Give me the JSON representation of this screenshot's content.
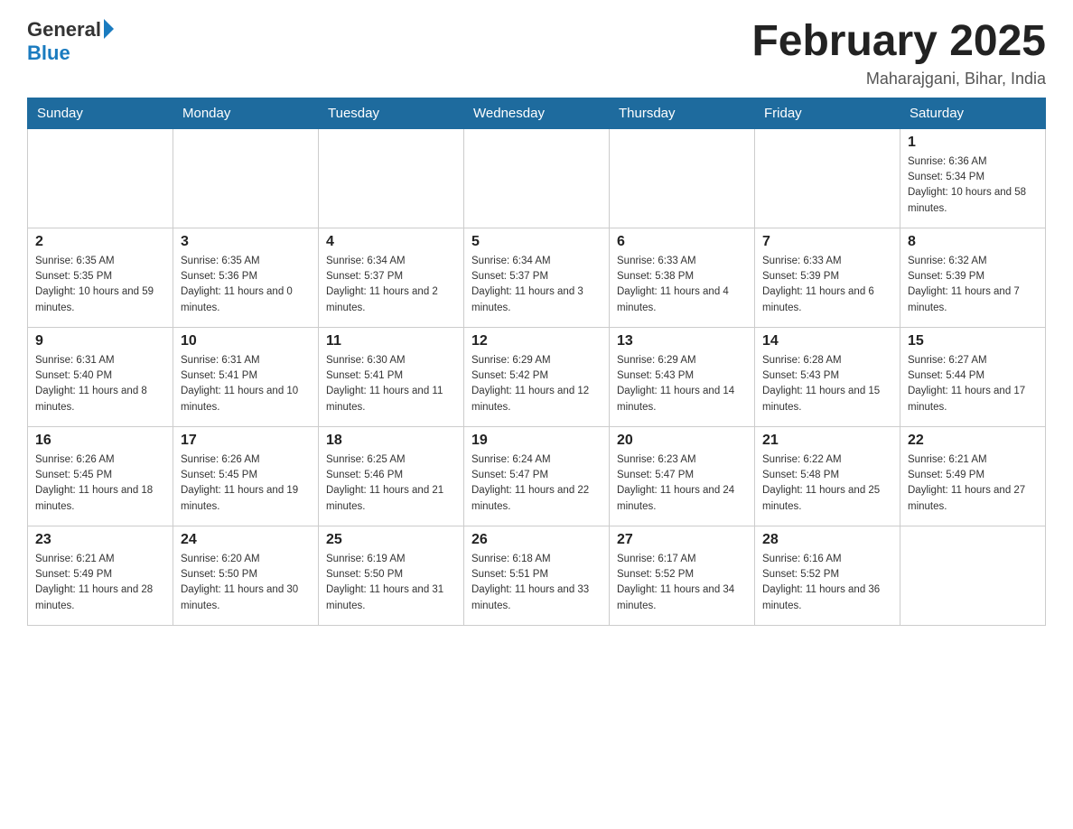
{
  "header": {
    "logo": {
      "general": "General",
      "blue": "Blue"
    },
    "title": "February 2025",
    "location": "Maharajgani, Bihar, India"
  },
  "weekdays": [
    "Sunday",
    "Monday",
    "Tuesday",
    "Wednesday",
    "Thursday",
    "Friday",
    "Saturday"
  ],
  "weeks": [
    [
      {
        "day": "",
        "sunrise": "",
        "sunset": "",
        "daylight": ""
      },
      {
        "day": "",
        "sunrise": "",
        "sunset": "",
        "daylight": ""
      },
      {
        "day": "",
        "sunrise": "",
        "sunset": "",
        "daylight": ""
      },
      {
        "day": "",
        "sunrise": "",
        "sunset": "",
        "daylight": ""
      },
      {
        "day": "",
        "sunrise": "",
        "sunset": "",
        "daylight": ""
      },
      {
        "day": "",
        "sunrise": "",
        "sunset": "",
        "daylight": ""
      },
      {
        "day": "1",
        "sunrise": "Sunrise: 6:36 AM",
        "sunset": "Sunset: 5:34 PM",
        "daylight": "Daylight: 10 hours and 58 minutes."
      }
    ],
    [
      {
        "day": "2",
        "sunrise": "Sunrise: 6:35 AM",
        "sunset": "Sunset: 5:35 PM",
        "daylight": "Daylight: 10 hours and 59 minutes."
      },
      {
        "day": "3",
        "sunrise": "Sunrise: 6:35 AM",
        "sunset": "Sunset: 5:36 PM",
        "daylight": "Daylight: 11 hours and 0 minutes."
      },
      {
        "day": "4",
        "sunrise": "Sunrise: 6:34 AM",
        "sunset": "Sunset: 5:37 PM",
        "daylight": "Daylight: 11 hours and 2 minutes."
      },
      {
        "day": "5",
        "sunrise": "Sunrise: 6:34 AM",
        "sunset": "Sunset: 5:37 PM",
        "daylight": "Daylight: 11 hours and 3 minutes."
      },
      {
        "day": "6",
        "sunrise": "Sunrise: 6:33 AM",
        "sunset": "Sunset: 5:38 PM",
        "daylight": "Daylight: 11 hours and 4 minutes."
      },
      {
        "day": "7",
        "sunrise": "Sunrise: 6:33 AM",
        "sunset": "Sunset: 5:39 PM",
        "daylight": "Daylight: 11 hours and 6 minutes."
      },
      {
        "day": "8",
        "sunrise": "Sunrise: 6:32 AM",
        "sunset": "Sunset: 5:39 PM",
        "daylight": "Daylight: 11 hours and 7 minutes."
      }
    ],
    [
      {
        "day": "9",
        "sunrise": "Sunrise: 6:31 AM",
        "sunset": "Sunset: 5:40 PM",
        "daylight": "Daylight: 11 hours and 8 minutes."
      },
      {
        "day": "10",
        "sunrise": "Sunrise: 6:31 AM",
        "sunset": "Sunset: 5:41 PM",
        "daylight": "Daylight: 11 hours and 10 minutes."
      },
      {
        "day": "11",
        "sunrise": "Sunrise: 6:30 AM",
        "sunset": "Sunset: 5:41 PM",
        "daylight": "Daylight: 11 hours and 11 minutes."
      },
      {
        "day": "12",
        "sunrise": "Sunrise: 6:29 AM",
        "sunset": "Sunset: 5:42 PM",
        "daylight": "Daylight: 11 hours and 12 minutes."
      },
      {
        "day": "13",
        "sunrise": "Sunrise: 6:29 AM",
        "sunset": "Sunset: 5:43 PM",
        "daylight": "Daylight: 11 hours and 14 minutes."
      },
      {
        "day": "14",
        "sunrise": "Sunrise: 6:28 AM",
        "sunset": "Sunset: 5:43 PM",
        "daylight": "Daylight: 11 hours and 15 minutes."
      },
      {
        "day": "15",
        "sunrise": "Sunrise: 6:27 AM",
        "sunset": "Sunset: 5:44 PM",
        "daylight": "Daylight: 11 hours and 17 minutes."
      }
    ],
    [
      {
        "day": "16",
        "sunrise": "Sunrise: 6:26 AM",
        "sunset": "Sunset: 5:45 PM",
        "daylight": "Daylight: 11 hours and 18 minutes."
      },
      {
        "day": "17",
        "sunrise": "Sunrise: 6:26 AM",
        "sunset": "Sunset: 5:45 PM",
        "daylight": "Daylight: 11 hours and 19 minutes."
      },
      {
        "day": "18",
        "sunrise": "Sunrise: 6:25 AM",
        "sunset": "Sunset: 5:46 PM",
        "daylight": "Daylight: 11 hours and 21 minutes."
      },
      {
        "day": "19",
        "sunrise": "Sunrise: 6:24 AM",
        "sunset": "Sunset: 5:47 PM",
        "daylight": "Daylight: 11 hours and 22 minutes."
      },
      {
        "day": "20",
        "sunrise": "Sunrise: 6:23 AM",
        "sunset": "Sunset: 5:47 PM",
        "daylight": "Daylight: 11 hours and 24 minutes."
      },
      {
        "day": "21",
        "sunrise": "Sunrise: 6:22 AM",
        "sunset": "Sunset: 5:48 PM",
        "daylight": "Daylight: 11 hours and 25 minutes."
      },
      {
        "day": "22",
        "sunrise": "Sunrise: 6:21 AM",
        "sunset": "Sunset: 5:49 PM",
        "daylight": "Daylight: 11 hours and 27 minutes."
      }
    ],
    [
      {
        "day": "23",
        "sunrise": "Sunrise: 6:21 AM",
        "sunset": "Sunset: 5:49 PM",
        "daylight": "Daylight: 11 hours and 28 minutes."
      },
      {
        "day": "24",
        "sunrise": "Sunrise: 6:20 AM",
        "sunset": "Sunset: 5:50 PM",
        "daylight": "Daylight: 11 hours and 30 minutes."
      },
      {
        "day": "25",
        "sunrise": "Sunrise: 6:19 AM",
        "sunset": "Sunset: 5:50 PM",
        "daylight": "Daylight: 11 hours and 31 minutes."
      },
      {
        "day": "26",
        "sunrise": "Sunrise: 6:18 AM",
        "sunset": "Sunset: 5:51 PM",
        "daylight": "Daylight: 11 hours and 33 minutes."
      },
      {
        "day": "27",
        "sunrise": "Sunrise: 6:17 AM",
        "sunset": "Sunset: 5:52 PM",
        "daylight": "Daylight: 11 hours and 34 minutes."
      },
      {
        "day": "28",
        "sunrise": "Sunrise: 6:16 AM",
        "sunset": "Sunset: 5:52 PM",
        "daylight": "Daylight: 11 hours and 36 minutes."
      },
      {
        "day": "",
        "sunrise": "",
        "sunset": "",
        "daylight": ""
      }
    ]
  ]
}
